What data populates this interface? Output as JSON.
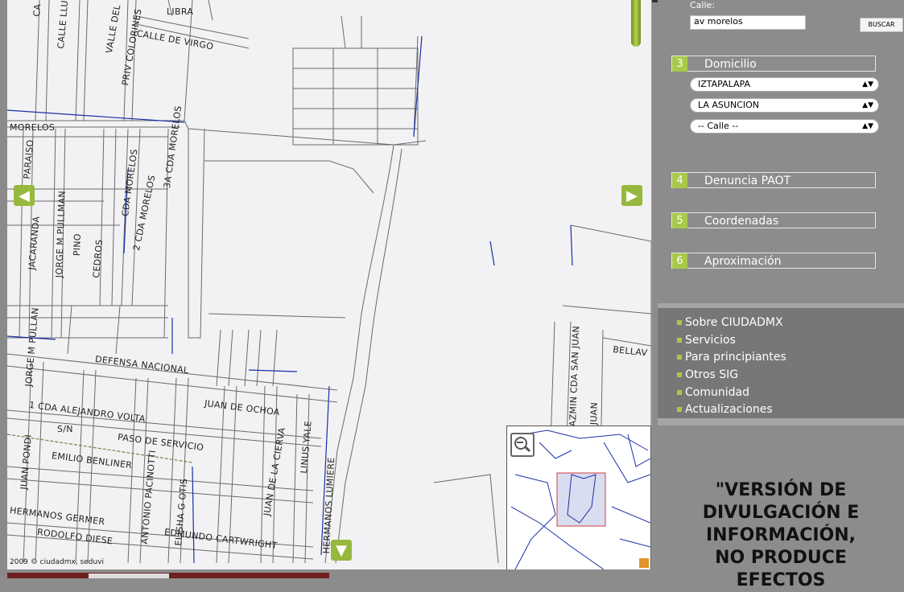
{
  "map": {
    "copyright": "2009 © ciudadmx, seduvi",
    "zoom_out_label": "−",
    "nav_left": "◀",
    "nav_right": "▶",
    "nav_down": "▼",
    "street_labels": [
      "LIBRA",
      "CALLE DE VIRGO",
      "VALLE DEL",
      "PRIV COLORINES",
      "CALLE LLU",
      "CA",
      "MORELOS",
      "PARAISO",
      "CDA MORELOS",
      "3A CDA MORELOS",
      "CDA MORELOS",
      "2 CDA MORELOS",
      "JORGE M PULLMAN",
      "JACARANDA",
      "PINO",
      "CEDROS",
      "DEFENSA NACIONAL",
      "JORGE M PULLAN",
      "JUAN DE OCHOA",
      "1 CDA ALEJANDRO VOLTA",
      "S/N",
      "PASO DE SERVICIO",
      "JUAN PONDI",
      "EMILIO BENLINER",
      "ANTONIO PACINOTTI",
      "ELISHA G OTIS",
      "JUAN DE LA CIERVA",
      "LINUS YALE",
      "HERMANOS LUMIERE",
      "HERMANOS GERMER",
      "EDMUNDO CARTWRIGHT",
      "RODOLFO DIESE",
      "AZMIN CDA SAN JUAN",
      "JUAN",
      "BELLAV"
    ]
  },
  "sidebar": {
    "calle_label": "Calle:",
    "street_value": "av morelos",
    "search_button": "BUSCAR",
    "steps": [
      {
        "num": "3",
        "label": "Domicilio"
      },
      {
        "num": "4",
        "label": "Denuncia PAOT"
      },
      {
        "num": "5",
        "label": "Coordenadas"
      },
      {
        "num": "6",
        "label": "Aproximación"
      }
    ],
    "selects": [
      "IZTAPALAPA",
      "LA ASUNCION",
      "-- Calle --"
    ],
    "links": [
      "Sobre CIUDADMX",
      "Servicios",
      "Para principiantes",
      "Otros SIG",
      "Comunidad",
      "Actualizaciones"
    ],
    "notice_lines": [
      "\"VERSIÓN DE",
      "DIVULGACIÓN E",
      "INFORMACIÓN,",
      "NO PRODUCE",
      "EFECTOS"
    ]
  },
  "colors": {
    "accent": "#a8c94a",
    "sidebar_bg": "#8c8c8c",
    "map_bg": "#f2f2f4",
    "road_line": "#555555",
    "blue_line": "#1a2fa8",
    "bottom_bar": "#6e1f1f"
  },
  "icons": {
    "zoom_out": "magnifier-minus-icon",
    "nav_left": "arrow-left-icon",
    "nav_right": "arrow-right-icon",
    "nav_down": "arrow-down-icon",
    "select_caret": "updown-caret-icon",
    "resize": "resize-corner-icon"
  }
}
